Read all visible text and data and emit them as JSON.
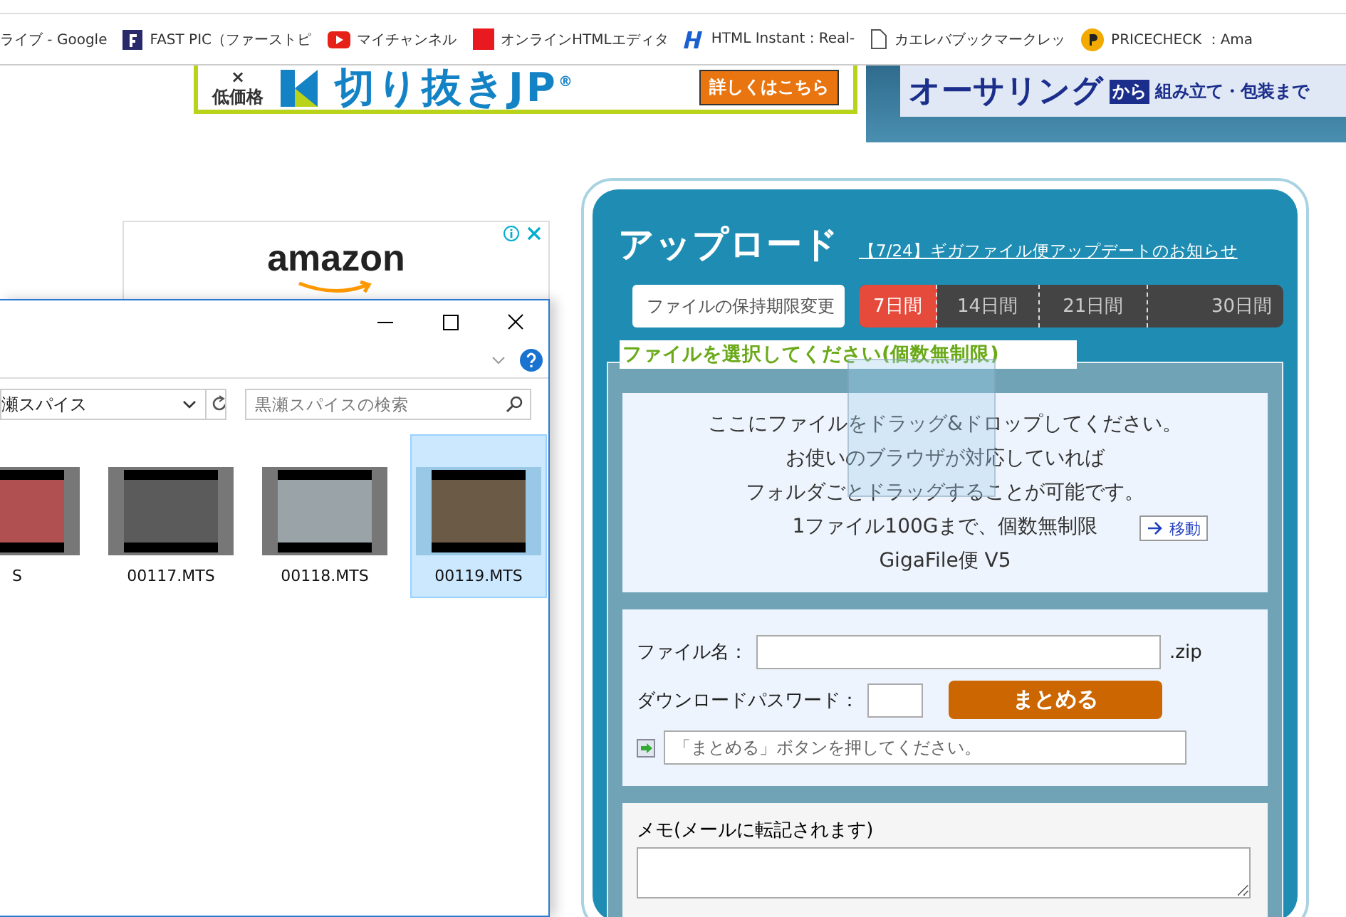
{
  "bookmarks": [
    {
      "label": "ライブ - Google",
      "kind": "none"
    },
    {
      "label": "FAST PIC（ファーストピ",
      "kind": "f"
    },
    {
      "label": "マイチャンネル",
      "kind": "youtube"
    },
    {
      "label": "オンラインHTMLエディタ",
      "kind": "square"
    },
    {
      "label": "HTML Instant : Real-",
      "kind": "h"
    },
    {
      "label": "カエレバブックマークレッ",
      "kind": "page"
    },
    {
      "label": "PRICECHECK ：Ama",
      "kind": "p"
    }
  ],
  "ads": {
    "left": {
      "mark": "×",
      "price": "低価格",
      "logo": "切り抜きJP",
      "reg": "®",
      "button": "詳しくはこちら"
    },
    "right": {
      "title": "オーサリング",
      "from": "から",
      "tagline": "組み立て・包装まで"
    },
    "amazon": {
      "logo": "amazon"
    }
  },
  "explorer": {
    "address": "瀬スパイス",
    "search_placeholder": "黒瀬スパイスの検索",
    "files": [
      {
        "name": "S",
        "selected": false
      },
      {
        "name": "00117.MTS",
        "selected": false
      },
      {
        "name": "00118.MTS",
        "selected": false
      },
      {
        "name": "00119.MTS",
        "selected": true
      }
    ]
  },
  "upload": {
    "title": "アップロード",
    "notice": "【7/24】ギガファイル便アップデートのお知らせ",
    "retention_label": "ファイルの保持期限変更",
    "periods": [
      {
        "label": "7日間",
        "selected": true
      },
      {
        "label": "14日間",
        "selected": false
      },
      {
        "label": "21日間",
        "selected": false
      },
      {
        "label": "30日間",
        "selected": false
      }
    ],
    "select_label": "ファイルを選択してください(個数無制限)",
    "drop_lines": [
      "ここにファイルをドラッグ&ドロップしてください。",
      "お使いのブラウザが対応していれば",
      "フォルダごとドラッグすることが可能です。",
      "1ファイル100Gまで、個数無制限",
      "GigaFile便 V5"
    ],
    "filename_label": "ファイル名：",
    "extension": ".zip",
    "password_label": "ダウンロードパスワード：",
    "bundle_button": "まとめる",
    "status_placeholder": "「まとめる」ボタンを押してください。",
    "memo_label": "メモ(メールに転記されます)"
  },
  "drag": {
    "tooltip": "移動"
  }
}
